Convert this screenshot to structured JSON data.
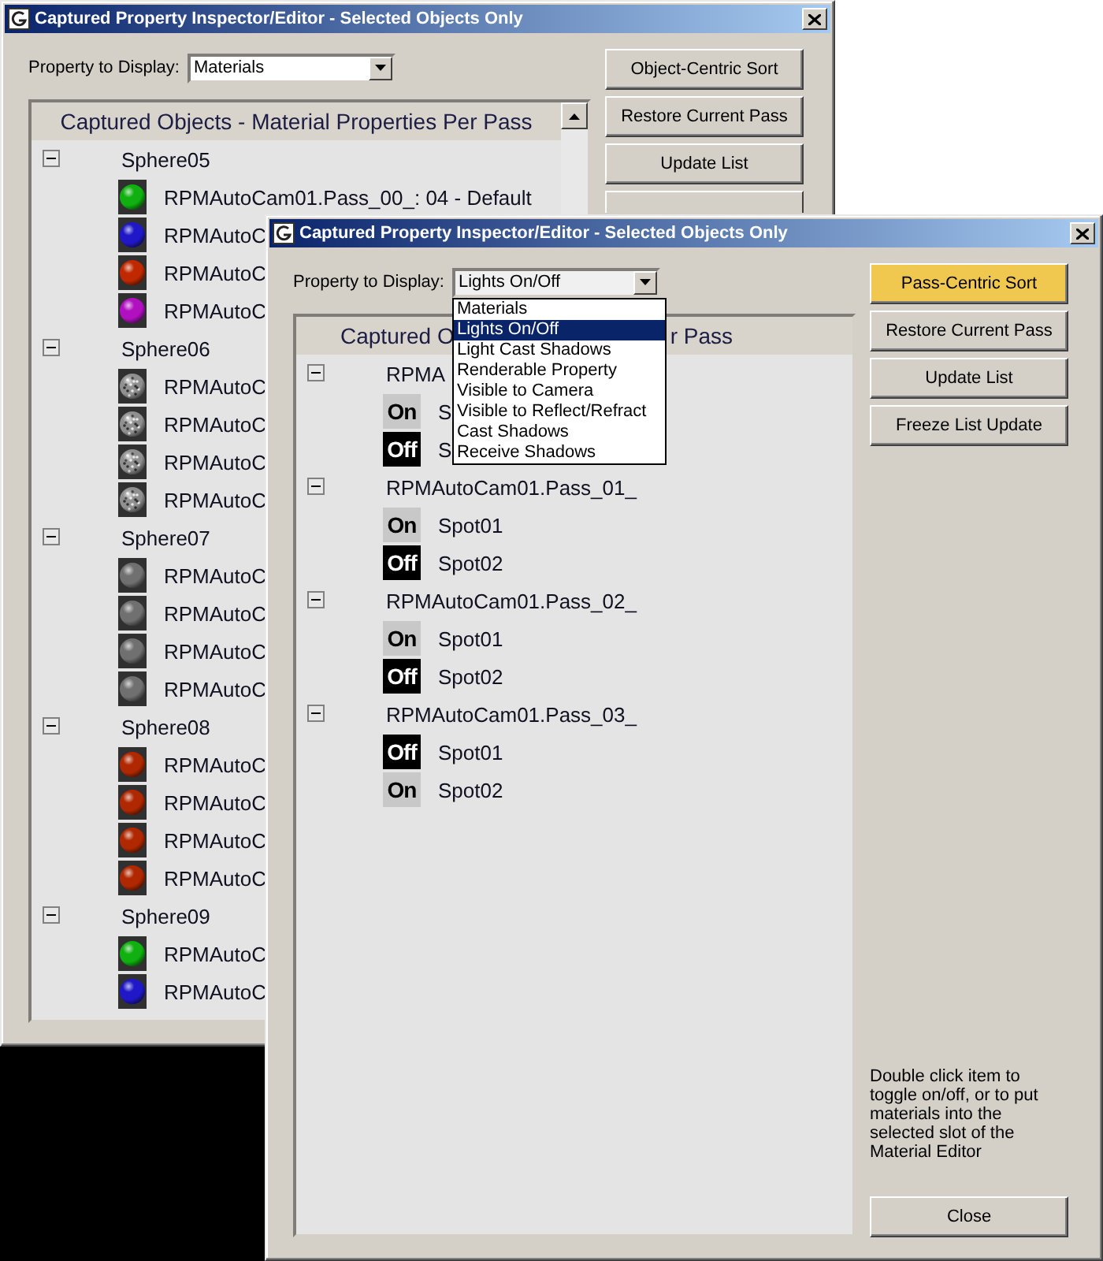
{
  "back_window": {
    "title": "Captured Property Inspector/Editor - Selected Objects Only",
    "property_label": "Property to Display:",
    "property_value": "Materials",
    "buttons": [
      {
        "label": "Object-Centric Sort",
        "selected": false
      },
      {
        "label": "Restore Current Pass",
        "selected": false
      },
      {
        "label": "Update List",
        "selected": false
      }
    ],
    "tree": {
      "header": "Captured Objects - Material Properties Per Pass",
      "groups": [
        {
          "name": "Sphere05",
          "expanded": true,
          "items": [
            {
              "label": "RPMAutoCam01.Pass_00_: 04 - Default",
              "kind": "plain",
              "color": "#10b010"
            },
            {
              "label": "RPMAutoC",
              "kind": "plain",
              "color": "#2018c8"
            },
            {
              "label": "RPMAutoC",
              "kind": "plain",
              "color": "#c02800"
            },
            {
              "label": "RPMAutoC",
              "kind": "plain",
              "color": "#b010c0"
            }
          ]
        },
        {
          "name": "Sphere06",
          "expanded": true,
          "items": [
            {
              "label": "RPMAutoC",
              "kind": "textured",
              "color": "#909090"
            },
            {
              "label": "RPMAutoC",
              "kind": "textured",
              "color": "#909090"
            },
            {
              "label": "RPMAutoC",
              "kind": "textured",
              "color": "#909090"
            },
            {
              "label": "RPMAutoC",
              "kind": "textured",
              "color": "#909090"
            }
          ]
        },
        {
          "name": "Sphere07",
          "expanded": true,
          "items": [
            {
              "label": "RPMAutoC",
              "kind": "plain",
              "color": "#707070"
            },
            {
              "label": "RPMAutoC",
              "kind": "plain",
              "color": "#707070"
            },
            {
              "label": "RPMAutoC",
              "kind": "plain",
              "color": "#707070"
            },
            {
              "label": "RPMAutoC",
              "kind": "plain",
              "color": "#707070"
            }
          ]
        },
        {
          "name": "Sphere08",
          "expanded": true,
          "items": [
            {
              "label": "RPMAutoC",
              "kind": "plain",
              "color": "#b02800"
            },
            {
              "label": "RPMAutoC",
              "kind": "plain",
              "color": "#b02800"
            },
            {
              "label": "RPMAutoC",
              "kind": "plain",
              "color": "#b02800"
            },
            {
              "label": "RPMAutoC",
              "kind": "plain",
              "color": "#b02800"
            }
          ]
        },
        {
          "name": "Sphere09",
          "expanded": true,
          "items": [
            {
              "label": "RPMAutoC",
              "kind": "plain",
              "color": "#10b010"
            },
            {
              "label": "RPMAutoC",
              "kind": "plain",
              "color": "#2018c8"
            }
          ]
        }
      ]
    }
  },
  "front_window": {
    "title": "Captured Property Inspector/Editor - Selected Objects Only",
    "property_label": "Property to Display:",
    "dropdown": {
      "value": "Lights On/Off",
      "expanded": true,
      "options": [
        {
          "label": "Materials",
          "selected": false
        },
        {
          "label": "Lights On/Off",
          "selected": true
        },
        {
          "label": "Light Cast Shadows",
          "selected": false
        },
        {
          "label": "Renderable Property",
          "selected": false
        },
        {
          "label": "Visible to Camera",
          "selected": false
        },
        {
          "label": "Visible to Reflect/Refract",
          "selected": false
        },
        {
          "label": "Cast Shadows",
          "selected": false
        },
        {
          "label": "Receive Shadows",
          "selected": false
        }
      ]
    },
    "buttons": [
      {
        "label": "Pass-Centric Sort",
        "selected": true
      },
      {
        "label": "Restore Current Pass",
        "selected": false
      },
      {
        "label": "Update List",
        "selected": false
      },
      {
        "label": "Freeze List Update",
        "selected": false
      }
    ],
    "tree": {
      "header_left": "Captured O",
      "header_right": "r Pass",
      "groups": [
        {
          "name": "RPMA",
          "expanded": true,
          "items": [
            {
              "badge": "On",
              "on": true,
              "label": "S"
            },
            {
              "badge": "Off",
              "on": false,
              "label": "S"
            }
          ]
        },
        {
          "name": "RPMAutoCam01.Pass_01_",
          "expanded": true,
          "items": [
            {
              "badge": "On",
              "on": true,
              "label": "Spot01"
            },
            {
              "badge": "Off",
              "on": false,
              "label": "Spot02"
            }
          ]
        },
        {
          "name": "RPMAutoCam01.Pass_02_",
          "expanded": true,
          "items": [
            {
              "badge": "On",
              "on": true,
              "label": "Spot01"
            },
            {
              "badge": "Off",
              "on": false,
              "label": "Spot02"
            }
          ]
        },
        {
          "name": "RPMAutoCam01.Pass_03_",
          "expanded": true,
          "items": [
            {
              "badge": "Off",
              "on": false,
              "label": "Spot01"
            },
            {
              "badge": "On",
              "on": true,
              "label": "Spot02"
            }
          ]
        }
      ]
    },
    "hint": "Double click item to toggle on/off, or to put materials into the selected slot of the Material Editor",
    "close_label": "Close"
  }
}
